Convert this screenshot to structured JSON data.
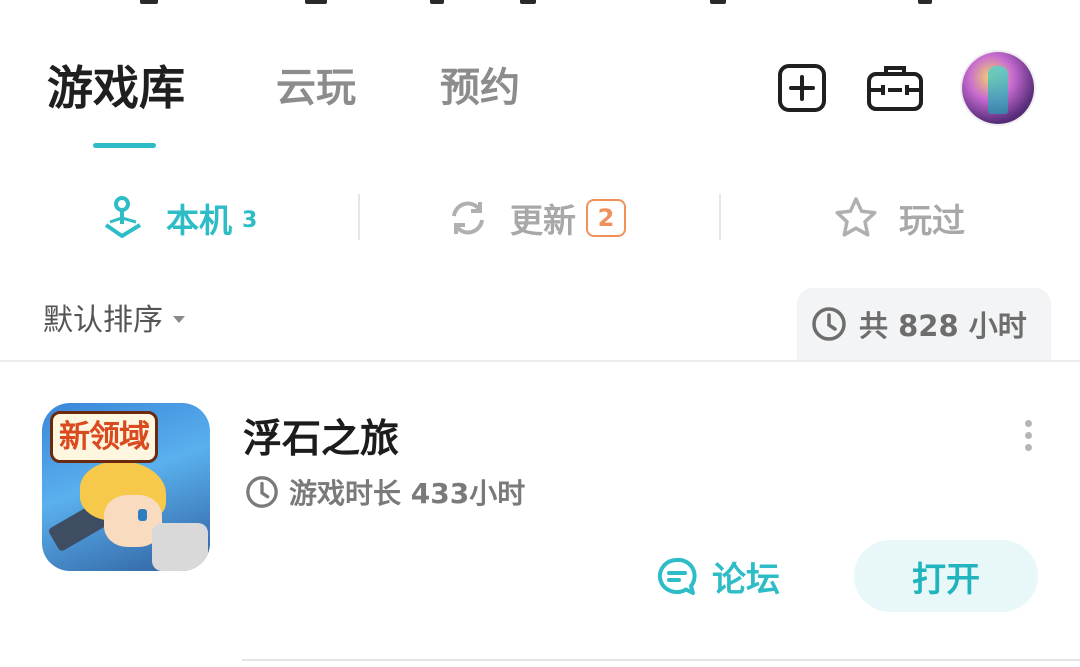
{
  "top_tabs": [
    {
      "label": "游戏库"
    },
    {
      "label": "云玩"
    },
    {
      "label": "预约"
    }
  ],
  "sub_tabs": {
    "local": {
      "label": "本机",
      "count": "3"
    },
    "update": {
      "label": "更新",
      "badge": "2"
    },
    "played": {
      "label": "玩过"
    }
  },
  "sort": {
    "label": "默认排序"
  },
  "total_time": {
    "text": "共 828 小时"
  },
  "game": {
    "icon_title": "新领域",
    "name": "浮石之旅",
    "play_time": "游戏时长 433小时",
    "forum_label": "论坛",
    "open_label": "打开"
  },
  "colors": {
    "accent": "#2ebdc7",
    "badge": "#f0915a"
  },
  "icons": [
    "add-icon",
    "toolbox-icon",
    "avatar",
    "joystick-icon",
    "refresh-icon",
    "star-icon",
    "clock-icon",
    "more-icon",
    "chat-icon"
  ]
}
